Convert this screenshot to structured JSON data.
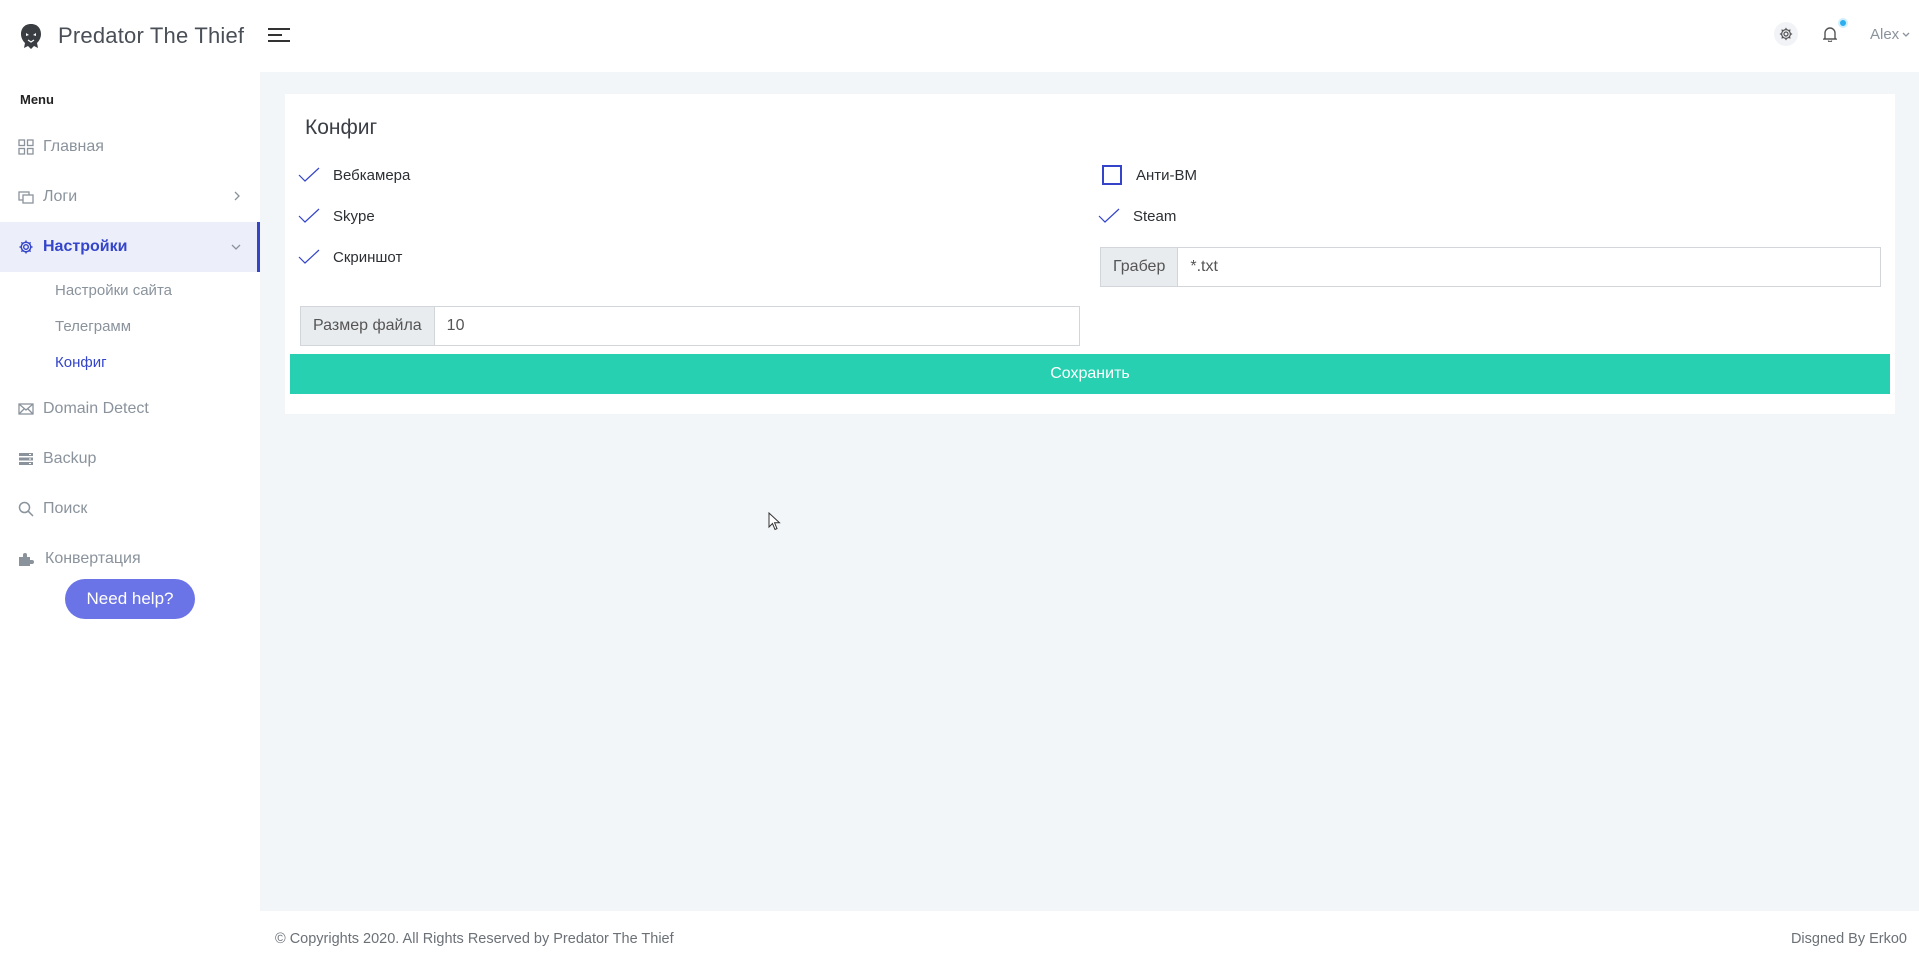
{
  "brand": {
    "name": "Predator The Thief"
  },
  "sidebar": {
    "menu_title": "Menu",
    "items": [
      {
        "label": "Главная",
        "icon": "grid-icon"
      },
      {
        "label": "Логи",
        "icon": "copy-icon"
      },
      {
        "label": "Настройки",
        "icon": "gear-icon"
      },
      {
        "label": "Domain Detect",
        "icon": "mail-icon"
      },
      {
        "label": "Backup",
        "icon": "server-icon"
      },
      {
        "label": "Поиск",
        "icon": "search-icon"
      },
      {
        "label": "Конвертация",
        "icon": "puzzle-icon"
      }
    ],
    "sub_items": [
      {
        "label": "Настройки сайта"
      },
      {
        "label": "Телеграмм"
      },
      {
        "label": "Конфиг"
      }
    ],
    "help_button": "Need help?"
  },
  "topbar": {
    "user": "Alex"
  },
  "config": {
    "title": "Конфиг",
    "checks": [
      {
        "label": "Вебкамера",
        "checked": true
      },
      {
        "label": "Skype",
        "checked": true
      },
      {
        "label": "Скриншот",
        "checked": true
      },
      {
        "label": "Анти-ВМ",
        "checked": false
      },
      {
        "label": "Steam",
        "checked": true
      }
    ],
    "grabber": {
      "label": "Грабер",
      "value": "*.txt"
    },
    "file_size": {
      "label": "Размер файла",
      "value": "10"
    },
    "save_button": "Сохранить"
  },
  "footer": {
    "copyright": "© Copyrights 2020. All Rights Reserved by Predator The Thief",
    "designer": "Disgned By Erko0"
  },
  "colors": {
    "accent": "#3445c9",
    "save": "#26d0b0",
    "help": "#6b74e6",
    "notification": "#2aaef0"
  }
}
